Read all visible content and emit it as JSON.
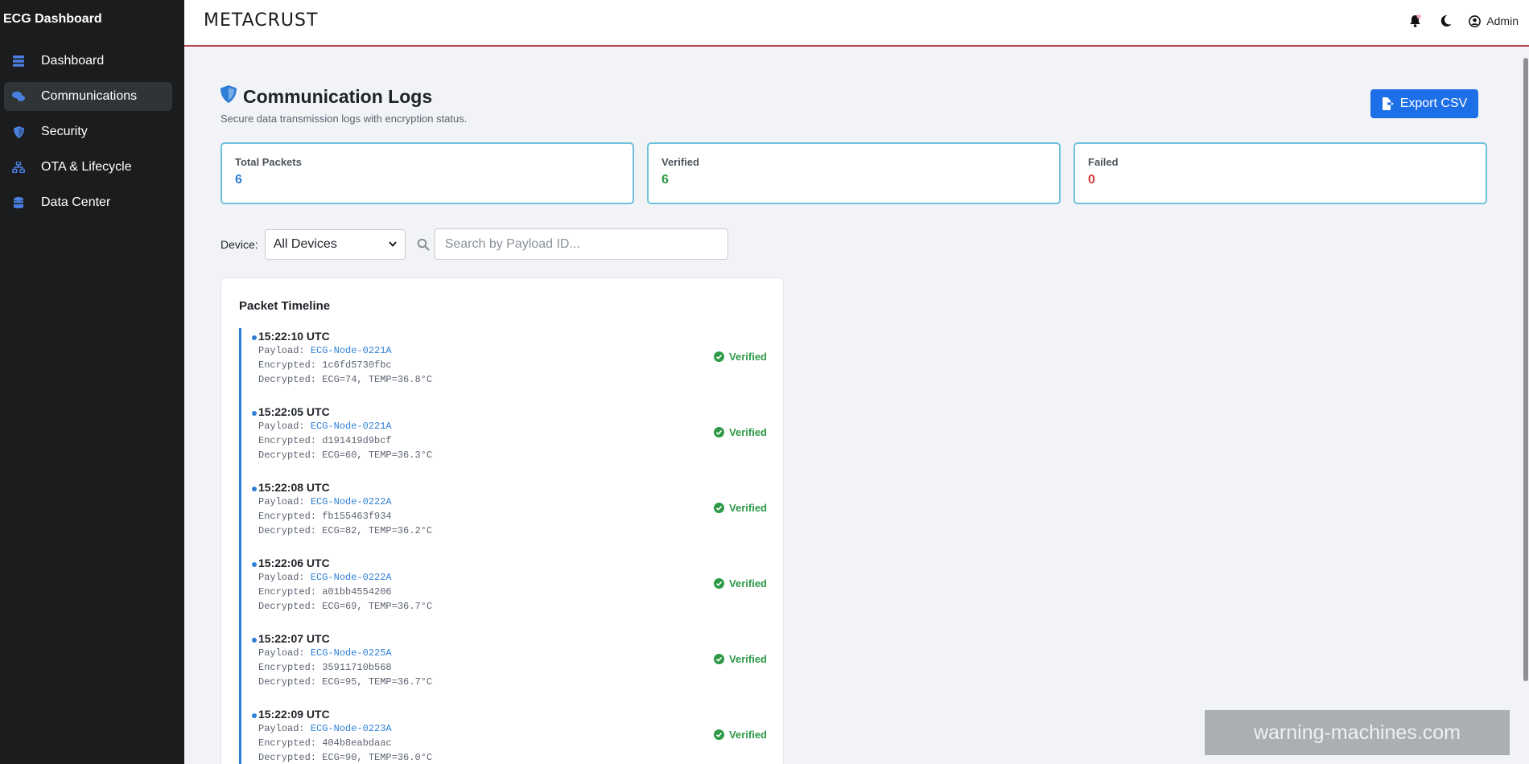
{
  "sidebar": {
    "brand": "ECG Dashboard",
    "items": [
      {
        "label": "Dashboard",
        "icon": "dashboard-icon"
      },
      {
        "label": "Communications",
        "icon": "chat-icon"
      },
      {
        "label": "Security",
        "icon": "shield-icon"
      },
      {
        "label": "OTA & Lifecycle",
        "icon": "network-icon"
      },
      {
        "label": "Data Center",
        "icon": "database-icon"
      }
    ],
    "active_index": 1
  },
  "topbar": {
    "logo_text": "METACRUST",
    "user_label": "Admin",
    "icons": [
      "bell-icon",
      "moon-icon",
      "user-circle-icon"
    ]
  },
  "page": {
    "title": "Communication Logs",
    "subtitle": "Secure data transmission logs with encryption status.",
    "export_label": "Export CSV"
  },
  "stats": [
    {
      "label": "Total Packets",
      "value": "6"
    },
    {
      "label": "Verified",
      "value": "6"
    },
    {
      "label": "Failed",
      "value": "0"
    }
  ],
  "filters": {
    "device_label": "Device:",
    "device_selected": "All Devices",
    "search_placeholder": "Search by Payload ID..."
  },
  "timeline": {
    "title": "Packet Timeline",
    "payload_prefix": "Payload:",
    "encrypted_prefix": "Encrypted:",
    "decrypted_prefix": "Decrypted:",
    "entries": [
      {
        "time": "15:22:10 UTC",
        "payload": "ECG-Node-0221A",
        "encrypted": "1c6fd5730fbc",
        "decrypted": "ECG=74, TEMP=36.8°C",
        "status": "Verified"
      },
      {
        "time": "15:22:05 UTC",
        "payload": "ECG-Node-0221A",
        "encrypted": "d191419d9bcf",
        "decrypted": "ECG=60, TEMP=36.3°C",
        "status": "Verified"
      },
      {
        "time": "15:22:08 UTC",
        "payload": "ECG-Node-0222A",
        "encrypted": "fb155463f934",
        "decrypted": "ECG=82, TEMP=36.2°C",
        "status": "Verified"
      },
      {
        "time": "15:22:06 UTC",
        "payload": "ECG-Node-0222A",
        "encrypted": "a01bb4554206",
        "decrypted": "ECG=69, TEMP=36.7°C",
        "status": "Verified"
      },
      {
        "time": "15:22:07 UTC",
        "payload": "ECG-Node-0225A",
        "encrypted": "35911710b568",
        "decrypted": "ECG=95, TEMP=36.7°C",
        "status": "Verified"
      },
      {
        "time": "15:22:09 UTC",
        "payload": "ECG-Node-0223A",
        "encrypted": "404b8eabdaac",
        "decrypted": "ECG=90, TEMP=36.0°C",
        "status": "Verified"
      }
    ]
  },
  "watermark": "warning-machines.com",
  "colors": {
    "accent": "#1d6fe8",
    "sidebar_bg": "#1b1c1d",
    "topbar_border": "#b5434a",
    "card_border": "#6ec0dc",
    "verified": "#2e9a48",
    "failed": "#d33a3a"
  }
}
